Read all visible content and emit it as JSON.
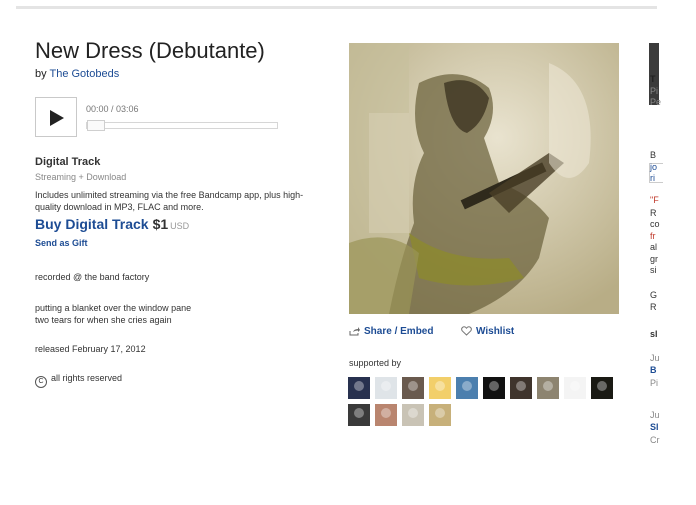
{
  "track": {
    "title": "New Dress (Debutante)",
    "by_prefix": "by",
    "artist": "The Gotobeds"
  },
  "player": {
    "time": "00:00 / 03:06",
    "progress_fraction": 0
  },
  "digital": {
    "title": "Digital Track",
    "subtitle": "Streaming + Download",
    "description": "Includes unlimited streaming via the free Bandcamp app, plus high-quality download in MP3, FLAC and more.",
    "buy_label": "Buy Digital Track",
    "price": "$1",
    "currency": "USD",
    "gift_label": "Send as Gift"
  },
  "about": {
    "line1": "recorded @ the band factory",
    "lyric1": "putting a blanket over the window pane",
    "lyric2": "two tears for when she cries again",
    "released": "released February 17, 2012",
    "rights": "all rights reserved"
  },
  "actions": {
    "share": "Share / Embed",
    "wishlist": "Wishlist"
  },
  "supporters": {
    "label": "supported by",
    "avatars": [
      {
        "icon": "supporter-avatar",
        "color": "#28314f"
      },
      {
        "icon": "supporter-avatar",
        "color": "#dfe4e8"
      },
      {
        "icon": "supporter-avatar",
        "color": "#6a5a4e"
      },
      {
        "icon": "supporter-avatar",
        "color": "#f2cf6a"
      },
      {
        "icon": "supporter-avatar",
        "color": "#4c7fae"
      },
      {
        "icon": "supporter-avatar",
        "color": "#111111"
      },
      {
        "icon": "supporter-avatar",
        "color": "#3f342c"
      },
      {
        "icon": "supporter-avatar",
        "color": "#8d8470"
      },
      {
        "icon": "supporter-avatar",
        "color": "#f4f4f4"
      },
      {
        "icon": "supporter-avatar",
        "color": "#1a1a14"
      },
      {
        "icon": "supporter-avatar",
        "color": "#3a3a3a"
      },
      {
        "icon": "supporter-avatar",
        "color": "#b9856f"
      },
      {
        "icon": "supporter-avatar",
        "color": "#c9c3b5"
      },
      {
        "icon": "supporter-avatar",
        "color": "#c7b07a"
      }
    ]
  },
  "sidebar": {
    "lines": [
      {
        "text": "T",
        "color": "#222",
        "bold": true
      },
      {
        "text": "Pi",
        "color": "#888"
      },
      {
        "text": "Pe",
        "color": "#888"
      },
      {
        "text": "B",
        "color": "#333"
      },
      {
        "text": "jo",
        "color": "#1d4c94"
      },
      {
        "text": "ri",
        "color": "#1d4c94"
      },
      {
        "text": "\"F",
        "color": "#c0392b"
      },
      {
        "text": "R",
        "color": "#333"
      },
      {
        "text": "co",
        "color": "#333"
      },
      {
        "text": "fr",
        "color": "#c0392b"
      },
      {
        "text": "al",
        "color": "#333"
      },
      {
        "text": "gr",
        "color": "#333"
      },
      {
        "text": "si",
        "color": "#333"
      },
      {
        "text": "G",
        "color": "#333"
      },
      {
        "text": "R",
        "color": "#333"
      },
      {
        "text": "sl",
        "color": "#333",
        "bold": true
      },
      {
        "text": "Ju",
        "color": "#888"
      },
      {
        "text": "B",
        "color": "#1d4c94",
        "bold": true
      },
      {
        "text": "Pi",
        "color": "#888"
      },
      {
        "text": "Ju",
        "color": "#888"
      },
      {
        "text": "Sl",
        "color": "#1d4c94",
        "bold": true
      },
      {
        "text": "Cr",
        "color": "#888"
      }
    ]
  },
  "colors": {
    "link": "#1d4c94",
    "text": "#333333",
    "muted": "#888888"
  }
}
